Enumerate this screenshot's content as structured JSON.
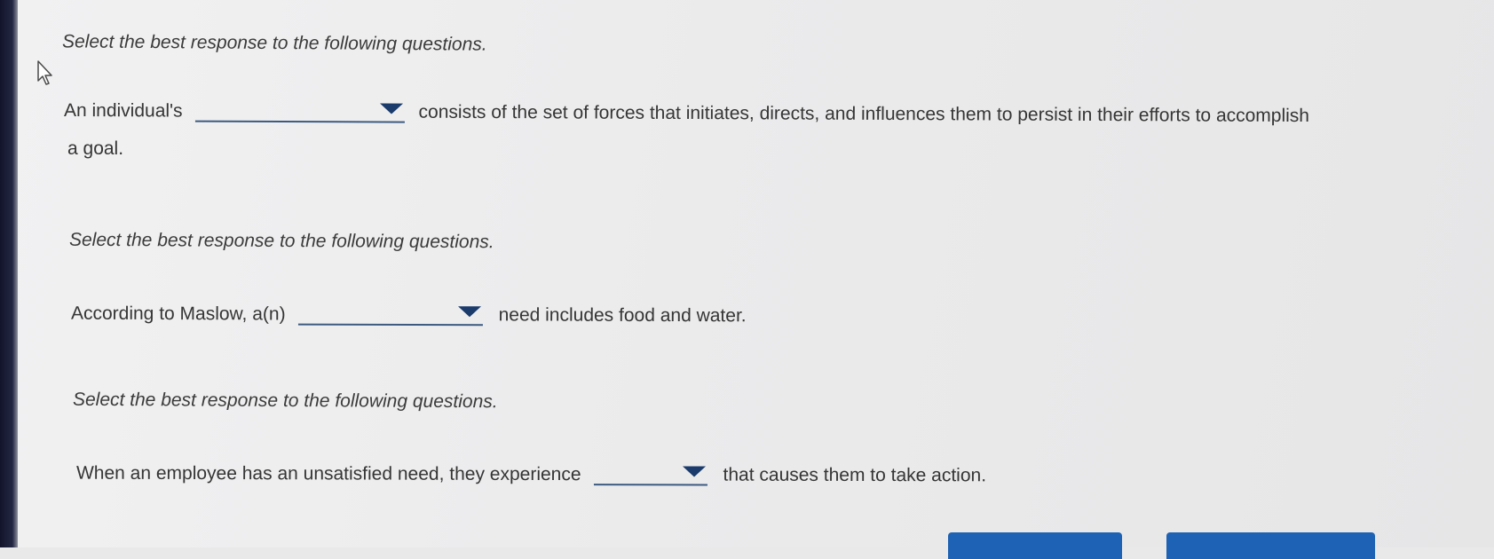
{
  "questions": [
    {
      "instruction": "Select the best response to the following questions.",
      "before": "An individual's",
      "after": "consists of the set of forces that initiates, directs, and influences them to persist in their efforts to accomplish",
      "continuation": "a goal.",
      "selected": ""
    },
    {
      "instruction": "Select the best response to the following questions.",
      "before": "According to Maslow, a(n)",
      "after": "need includes food and water.",
      "selected": ""
    },
    {
      "instruction": "Select the best response to the following questions.",
      "before": "When an employee has an unsatisfied need, they experience",
      "after": "that causes them to take action.",
      "selected": ""
    }
  ],
  "colors": {
    "dropdown_arrow": "#1a3b6b",
    "dropdown_underline": "#3c5a80",
    "button": "#1d62b4"
  },
  "icons": {
    "cursor": "pointer-cursor-icon",
    "dropdown": "triangle-down-icon"
  }
}
